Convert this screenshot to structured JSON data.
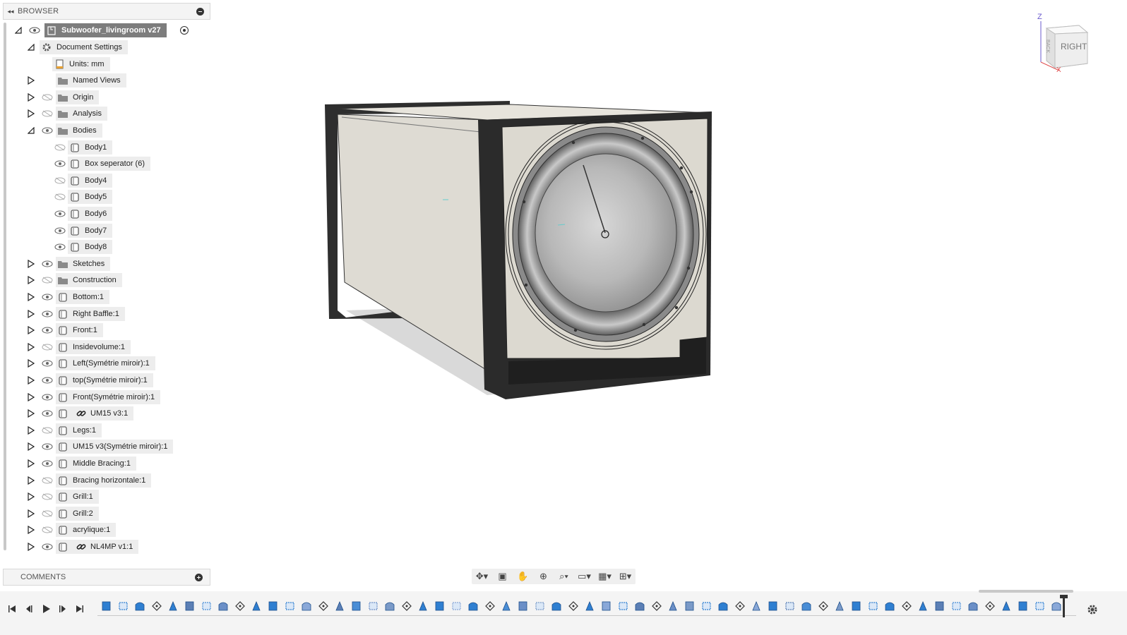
{
  "browser": {
    "title": "BROWSER",
    "root": {
      "label": "Subwoofer_livingroom v27"
    },
    "items": [
      {
        "label": "Document Settings",
        "icon": "gear-icon",
        "level": 1,
        "expanded": true,
        "visible": null
      },
      {
        "label": "Units: mm",
        "icon": "document-icon",
        "level": 2,
        "expanded": null,
        "visible": null
      },
      {
        "label": "Named Views",
        "icon": "folder-icon",
        "level": 1,
        "expanded": false,
        "visible": null
      },
      {
        "label": "Origin",
        "icon": "folder-icon",
        "level": 1,
        "expanded": false,
        "visible": false
      },
      {
        "label": "Analysis",
        "icon": "folder-icon",
        "level": 1,
        "expanded": false,
        "visible": false
      },
      {
        "label": "Bodies",
        "icon": "folder-icon",
        "level": 1,
        "expanded": true,
        "visible": true
      },
      {
        "label": "Body1",
        "icon": "body-icon",
        "level": 2,
        "expanded": null,
        "visible": false
      },
      {
        "label": "Box seperator (6)",
        "icon": "body-icon",
        "level": 2,
        "expanded": null,
        "visible": true
      },
      {
        "label": "Body4",
        "icon": "body-icon",
        "level": 2,
        "expanded": null,
        "visible": false
      },
      {
        "label": "Body5",
        "icon": "body-icon",
        "level": 2,
        "expanded": null,
        "visible": false
      },
      {
        "label": "Body6",
        "icon": "body-icon",
        "level": 2,
        "expanded": null,
        "visible": true
      },
      {
        "label": "Body7",
        "icon": "body-icon",
        "level": 2,
        "expanded": null,
        "visible": true
      },
      {
        "label": "Body8",
        "icon": "body-icon",
        "level": 2,
        "expanded": null,
        "visible": true
      },
      {
        "label": "Sketches",
        "icon": "folder-icon",
        "level": 1,
        "expanded": false,
        "visible": true
      },
      {
        "label": "Construction",
        "icon": "folder-icon",
        "level": 1,
        "expanded": false,
        "visible": false
      },
      {
        "label": "Bottom:1",
        "icon": "component-icon",
        "level": 1,
        "expanded": false,
        "visible": true
      },
      {
        "label": "Right Baffle:1",
        "icon": "component-icon",
        "level": 1,
        "expanded": false,
        "visible": true
      },
      {
        "label": "Front:1",
        "icon": "component-icon",
        "level": 1,
        "expanded": false,
        "visible": true
      },
      {
        "label": "Insidevolume:1",
        "icon": "component-icon",
        "level": 1,
        "expanded": false,
        "visible": false
      },
      {
        "label": "Left(Symétrie miroir):1",
        "icon": "component-icon",
        "level": 1,
        "expanded": false,
        "visible": true
      },
      {
        "label": "top(Symétrie miroir):1",
        "icon": "component-icon",
        "level": 1,
        "expanded": false,
        "visible": true
      },
      {
        "label": "Front(Symétrie miroir):1",
        "icon": "component-icon",
        "level": 1,
        "expanded": false,
        "visible": true
      },
      {
        "label": "UM15 v3:1",
        "icon": "component-icon",
        "level": 1,
        "expanded": false,
        "visible": true,
        "linked": true
      },
      {
        "label": "Legs:1",
        "icon": "component-icon",
        "level": 1,
        "expanded": false,
        "visible": false
      },
      {
        "label": "UM15 v3(Symétrie miroir):1",
        "icon": "component-icon",
        "level": 1,
        "expanded": false,
        "visible": true
      },
      {
        "label": "Middle Bracing:1",
        "icon": "component-icon",
        "level": 1,
        "expanded": false,
        "visible": true
      },
      {
        "label": "Bracing horizontale:1",
        "icon": "component-icon",
        "level": 1,
        "expanded": false,
        "visible": false
      },
      {
        "label": "Grill:1",
        "icon": "component-icon",
        "level": 1,
        "expanded": false,
        "visible": false
      },
      {
        "label": "Grill:2",
        "icon": "component-icon",
        "level": 1,
        "expanded": false,
        "visible": false
      },
      {
        "label": "acrylique:1",
        "icon": "component-icon",
        "level": 1,
        "expanded": false,
        "visible": false
      },
      {
        "label": "NL4MP v1:1",
        "icon": "component-icon",
        "level": 1,
        "expanded": false,
        "visible": true,
        "linked": true
      }
    ]
  },
  "comments": {
    "title": "COMMENTS"
  },
  "viewcube": {
    "face": "RIGHT",
    "axis_z": "Z",
    "axis_x": "X",
    "face_side": "BACK"
  },
  "nav_toolbar": [
    "orbit-icon",
    "look-at-icon",
    "pan-icon",
    "zoom-icon",
    "fit-icon",
    "display-settings-icon",
    "grid-icon",
    "viewports-icon"
  ],
  "colors": {
    "selected": "#7d7d7d",
    "panel": "#f4f4f4",
    "pill": "#ededed",
    "axis_z": "#6a5acd",
    "axis_x": "#e05050"
  }
}
